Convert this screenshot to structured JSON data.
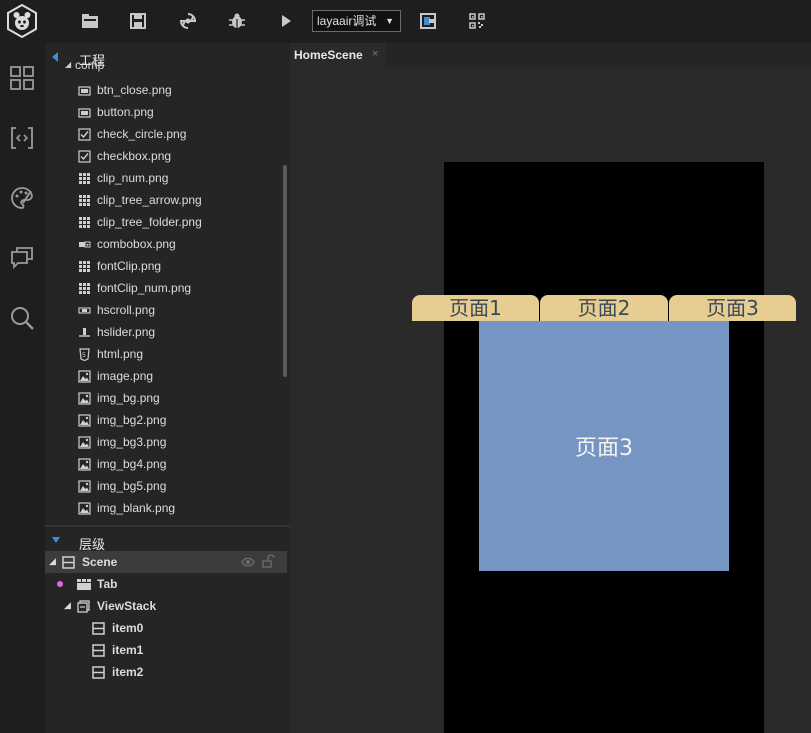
{
  "toolbar": {
    "buttons": [
      "folder-icon",
      "save-icon",
      "sync-icon",
      "debug-icon",
      "play-icon",
      "export-icon",
      "qrcode-icon"
    ],
    "run_mode": {
      "selected": "layaair调试"
    }
  },
  "rail": {
    "items": [
      "components-icon",
      "code-icon",
      "palette-icon",
      "chat-icon",
      "search-icon"
    ]
  },
  "project_panel": {
    "title": "工程",
    "folder_label": "comp",
    "files": [
      {
        "name": "btn_close.png",
        "icon": "button-image-icon"
      },
      {
        "name": "button.png",
        "icon": "button-image-icon"
      },
      {
        "name": "check_circle.png",
        "icon": "checkbox-image-icon"
      },
      {
        "name": "checkbox.png",
        "icon": "checkbox-image-icon"
      },
      {
        "name": "clip_num.png",
        "icon": "clip-image-icon"
      },
      {
        "name": "clip_tree_arrow.png",
        "icon": "clip-image-icon"
      },
      {
        "name": "clip_tree_folder.png",
        "icon": "clip-image-icon"
      },
      {
        "name": "combobox.png",
        "icon": "combobox-image-icon"
      },
      {
        "name": "fontClip.png",
        "icon": "clip-image-icon"
      },
      {
        "name": "fontClip_num.png",
        "icon": "clip-image-icon"
      },
      {
        "name": "hscroll.png",
        "icon": "hscroll-image-icon"
      },
      {
        "name": "hslider.png",
        "icon": "hslider-image-icon"
      },
      {
        "name": "html.png",
        "icon": "html-image-icon"
      },
      {
        "name": "image.png",
        "icon": "picture-icon"
      },
      {
        "name": "img_bg.png",
        "icon": "picture-icon"
      },
      {
        "name": "img_bg2.png",
        "icon": "picture-icon"
      },
      {
        "name": "img_bg3.png",
        "icon": "picture-icon"
      },
      {
        "name": "img_bg4.png",
        "icon": "picture-icon"
      },
      {
        "name": "img_bg5.png",
        "icon": "picture-icon"
      },
      {
        "name": "img_blank.png",
        "icon": "picture-icon"
      }
    ]
  },
  "hierarchy_panel": {
    "title": "层级",
    "nodes": [
      {
        "label": "Scene"
      },
      {
        "label": "Tab"
      },
      {
        "label": "ViewStack"
      },
      {
        "label": "item0"
      },
      {
        "label": "item1"
      },
      {
        "label": "item2"
      }
    ]
  },
  "editor": {
    "tab_label": "HomeScene",
    "tab_close": "×",
    "scene_tabs": [
      "页面1",
      "页面2",
      "页面3"
    ],
    "view_label": "页面3"
  },
  "colors": {
    "tab_fill": "#e8cd92",
    "view_fill": "#7795c2",
    "stage_bg": "#000000",
    "accent_arrow": "#3a8fd8",
    "tab_marker": "#e06adf"
  }
}
